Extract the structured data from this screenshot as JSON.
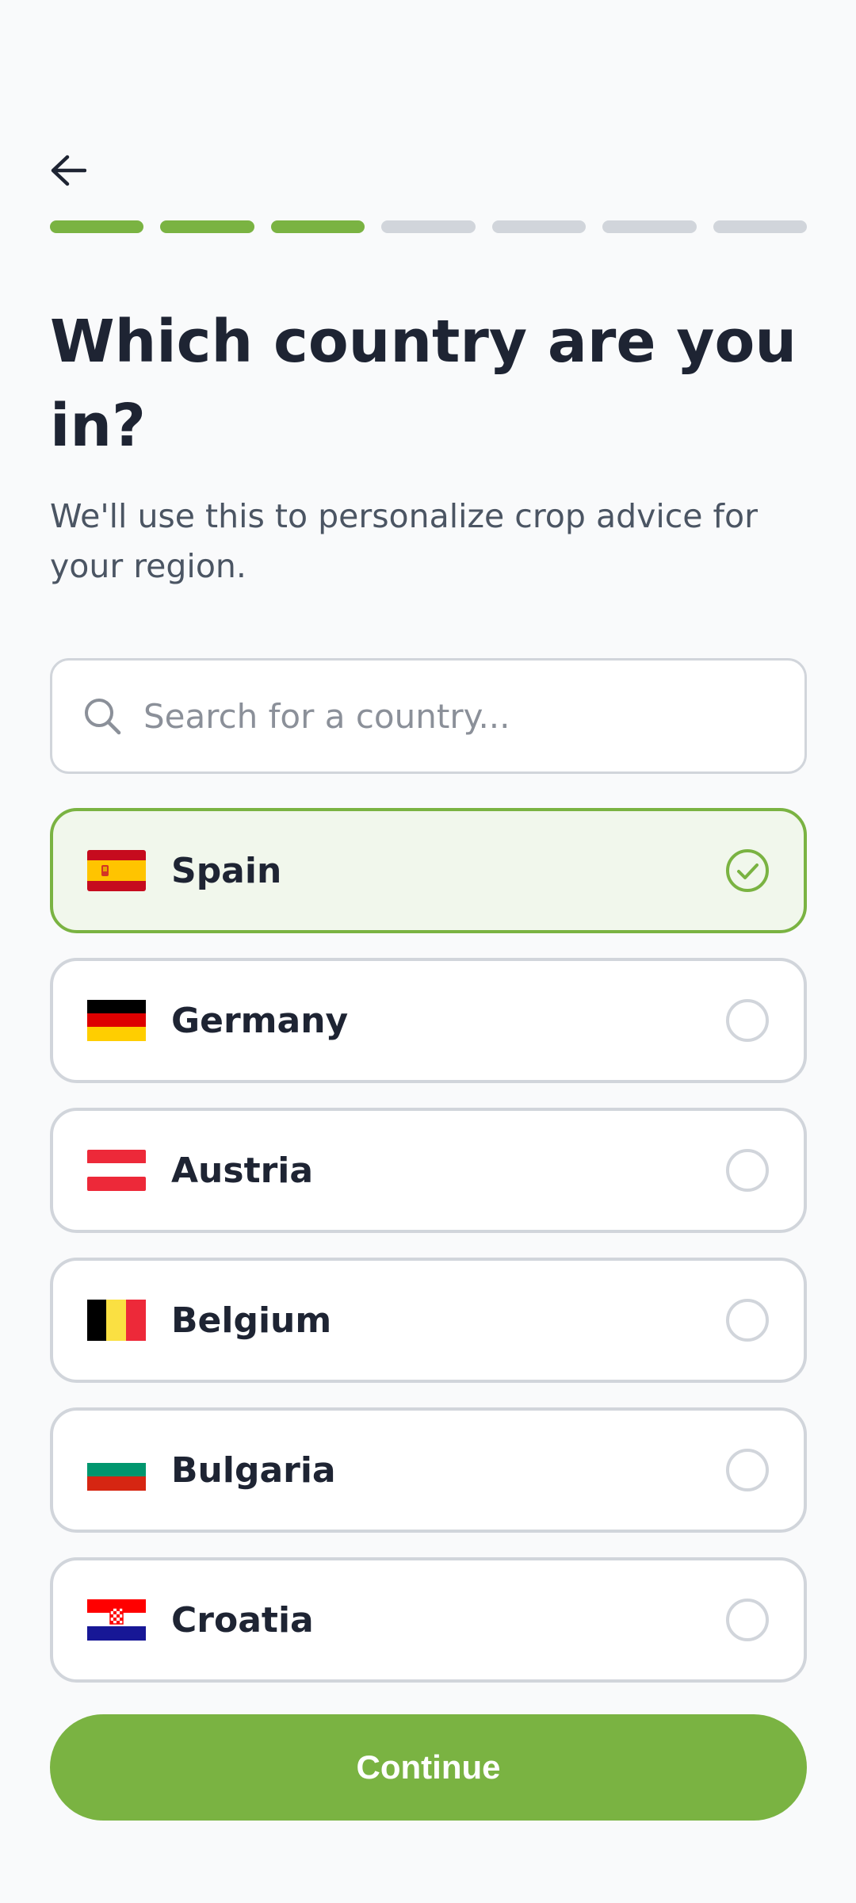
{
  "header": {
    "back_icon": "arrow-left-icon",
    "progress": {
      "total_steps": 7,
      "completed_steps": 3
    }
  },
  "main": {
    "title": "Which country are you in?",
    "subtitle": "We'll use this to personalize crop advice for your region."
  },
  "search": {
    "icon": "search-icon",
    "placeholder": "Search for a country...",
    "value": ""
  },
  "countries": [
    {
      "label": "Spain",
      "flag": "spain-flag-icon",
      "selected": true
    },
    {
      "label": "Germany",
      "flag": "germany-flag-icon",
      "selected": false
    },
    {
      "label": "Austria",
      "flag": "austria-flag-icon",
      "selected": false
    },
    {
      "label": "Belgium",
      "flag": "belgium-flag-icon",
      "selected": false
    },
    {
      "label": "Bulgaria",
      "flag": "bulgaria-flag-icon",
      "selected": false
    },
    {
      "label": "Croatia",
      "flag": "croatia-flag-icon",
      "selected": false
    }
  ],
  "footer": {
    "continue_label": "Continue"
  },
  "colors": {
    "accent": "#7ab342",
    "accent_bg": "#f1f7ec",
    "border": "#d1d5db",
    "text_primary": "#1e2433",
    "text_secondary": "#4b5563",
    "progress_inactive": "#d1d5db"
  }
}
